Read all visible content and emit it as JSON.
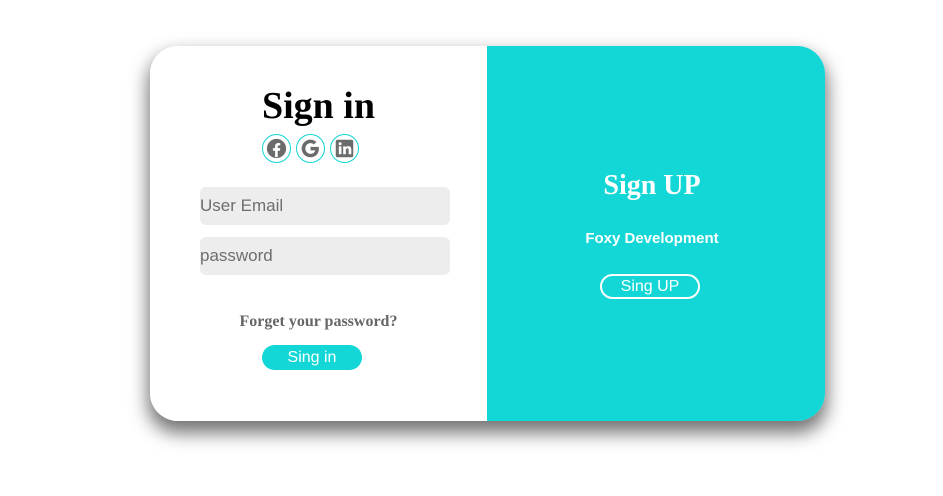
{
  "signin": {
    "title": "Sign in",
    "social": [
      {
        "name": "facebook-icon"
      },
      {
        "name": "google-icon"
      },
      {
        "name": "linkedin-icon"
      }
    ],
    "email_placeholder": "User Email",
    "password_placeholder": "password",
    "forgot_label": "Forget your password?",
    "button_label": "Sing in"
  },
  "signup": {
    "title": "Sign UP",
    "subtitle": "Foxy Development",
    "button_label": "Sing UP"
  },
  "colors": {
    "accent": "#13d6d6",
    "input_bg": "#ededed",
    "muted_text": "#666666",
    "icon_gray": "#6b6b6b"
  }
}
